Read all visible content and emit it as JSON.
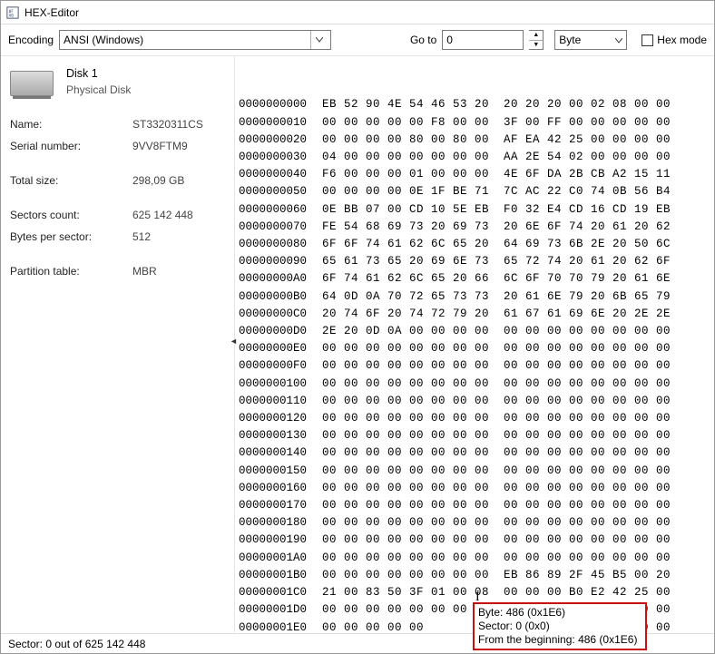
{
  "window": {
    "title": "HEX-Editor"
  },
  "toolbar": {
    "encoding_label": "Encoding",
    "encoding_value": "ANSI (Windows)",
    "goto_label": "Go to",
    "goto_value": "0",
    "unit_value": "Byte",
    "hexmode_label": "Hex mode"
  },
  "disk": {
    "title": "Disk 1",
    "subtitle": "Physical Disk",
    "fields": [
      {
        "label": "Name:",
        "value": "ST3320311CS"
      },
      {
        "label": "Serial number:",
        "value": "9VV8FTM9"
      },
      {
        "label": "",
        "value": ""
      },
      {
        "label": "Total size:",
        "value": "298,09 GB"
      },
      {
        "label": "",
        "value": ""
      },
      {
        "label": "Sectors count:",
        "value": "625 142 448"
      },
      {
        "label": "Bytes per sector:",
        "value": "512"
      },
      {
        "label": "",
        "value": ""
      },
      {
        "label": "Partition table:",
        "value": "MBR"
      }
    ]
  },
  "hex": {
    "rows": [
      {
        "offset": "0000000000",
        "bytes": "EB 52 90 4E 54 46 53 20  20 20 20 00 02 08 00 00"
      },
      {
        "offset": "0000000010",
        "bytes": "00 00 00 00 00 F8 00 00  3F 00 FF 00 00 00 00 00"
      },
      {
        "offset": "0000000020",
        "bytes": "00 00 00 00 80 00 80 00  AF EA 42 25 00 00 00 00"
      },
      {
        "offset": "0000000030",
        "bytes": "04 00 00 00 00 00 00 00  AA 2E 54 02 00 00 00 00"
      },
      {
        "offset": "0000000040",
        "bytes": "F6 00 00 00 01 00 00 00  4E 6F DA 2B CB A2 15 11"
      },
      {
        "offset": "0000000050",
        "bytes": "00 00 00 00 0E 1F BE 71  7C AC 22 C0 74 0B 56 B4"
      },
      {
        "offset": "0000000060",
        "bytes": "0E BB 07 00 CD 10 5E EB  F0 32 E4 CD 16 CD 19 EB"
      },
      {
        "offset": "0000000070",
        "bytes": "FE 54 68 69 73 20 69 73  20 6E 6F 74 20 61 20 62"
      },
      {
        "offset": "0000000080",
        "bytes": "6F 6F 74 61 62 6C 65 20  64 69 73 6B 2E 20 50 6C"
      },
      {
        "offset": "0000000090",
        "bytes": "65 61 73 65 20 69 6E 73  65 72 74 20 61 20 62 6F"
      },
      {
        "offset": "00000000A0",
        "bytes": "6F 74 61 62 6C 65 20 66  6C 6F 70 70 79 20 61 6E"
      },
      {
        "offset": "00000000B0",
        "bytes": "64 0D 0A 70 72 65 73 73  20 61 6E 79 20 6B 65 79"
      },
      {
        "offset": "00000000C0",
        "bytes": "20 74 6F 20 74 72 79 20  61 67 61 69 6E 20 2E 2E"
      },
      {
        "offset": "00000000D0",
        "bytes": "2E 20 0D 0A 00 00 00 00  00 00 00 00 00 00 00 00"
      },
      {
        "offset": "00000000E0",
        "bytes": "00 00 00 00 00 00 00 00  00 00 00 00 00 00 00 00"
      },
      {
        "offset": "00000000F0",
        "bytes": "00 00 00 00 00 00 00 00  00 00 00 00 00 00 00 00"
      },
      {
        "offset": "0000000100",
        "bytes": "00 00 00 00 00 00 00 00  00 00 00 00 00 00 00 00"
      },
      {
        "offset": "0000000110",
        "bytes": "00 00 00 00 00 00 00 00  00 00 00 00 00 00 00 00"
      },
      {
        "offset": "0000000120",
        "bytes": "00 00 00 00 00 00 00 00  00 00 00 00 00 00 00 00"
      },
      {
        "offset": "0000000130",
        "bytes": "00 00 00 00 00 00 00 00  00 00 00 00 00 00 00 00"
      },
      {
        "offset": "0000000140",
        "bytes": "00 00 00 00 00 00 00 00  00 00 00 00 00 00 00 00"
      },
      {
        "offset": "0000000150",
        "bytes": "00 00 00 00 00 00 00 00  00 00 00 00 00 00 00 00"
      },
      {
        "offset": "0000000160",
        "bytes": "00 00 00 00 00 00 00 00  00 00 00 00 00 00 00 00"
      },
      {
        "offset": "0000000170",
        "bytes": "00 00 00 00 00 00 00 00  00 00 00 00 00 00 00 00"
      },
      {
        "offset": "0000000180",
        "bytes": "00 00 00 00 00 00 00 00  00 00 00 00 00 00 00 00"
      },
      {
        "offset": "0000000190",
        "bytes": "00 00 00 00 00 00 00 00  00 00 00 00 00 00 00 00"
      },
      {
        "offset": "00000001A0",
        "bytes": "00 00 00 00 00 00 00 00  00 00 00 00 00 00 00 00"
      },
      {
        "offset": "00000001B0",
        "bytes": "00 00 00 00 00 00 00 00  EB 86 89 2F 45 B5 00 20"
      },
      {
        "offset": "00000001C0",
        "bytes": "21 00 83 50 3F 01 00 08  00 00 00 B0 E2 42 25 00"
      },
      {
        "offset": "00000001D0",
        "bytes": "00 00 00 00 00 00 00 00  00 00 00 00 00 00 00 00"
      },
      {
        "offset": "00000001E0",
        "bytes": "00 00 00 00 00                       00 00 00 00"
      }
    ]
  },
  "tooltip": {
    "line1": "Byte: 486 (0x1E6)",
    "line2": "Sector: 0 (0x0)",
    "line3": "From the beginning: 486 (0x1E6)"
  },
  "statusbar": {
    "text": "Sector: 0 out of 625 142 448"
  }
}
